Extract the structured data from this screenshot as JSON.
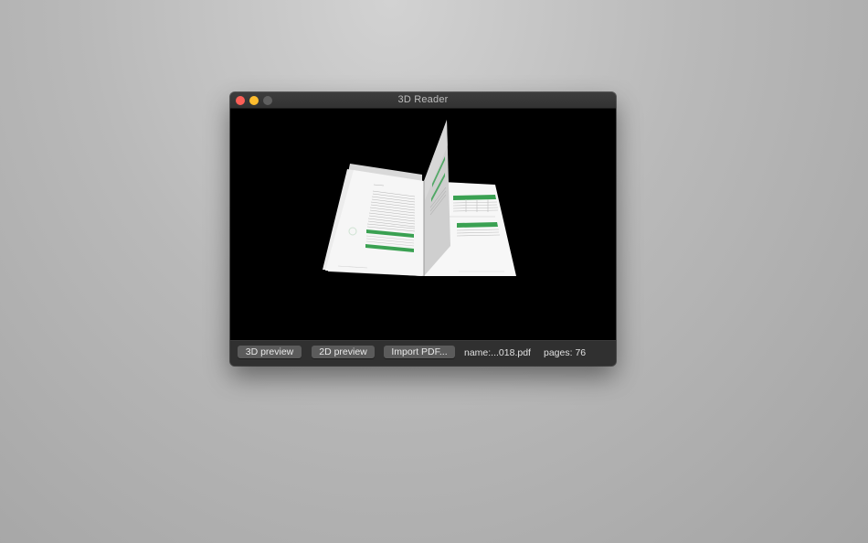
{
  "window": {
    "title": "3D Reader"
  },
  "toolbar": {
    "preview_3d_label": "3D preview",
    "preview_2d_label": "2D preview",
    "import_label": "Import PDF...",
    "name_text": "name:...018.pdf",
    "pages_text": "pages: 76"
  },
  "colors": {
    "viewport_background": "#000000",
    "table_header_green": "#3aa152",
    "button_background": "#5b5b5b"
  }
}
